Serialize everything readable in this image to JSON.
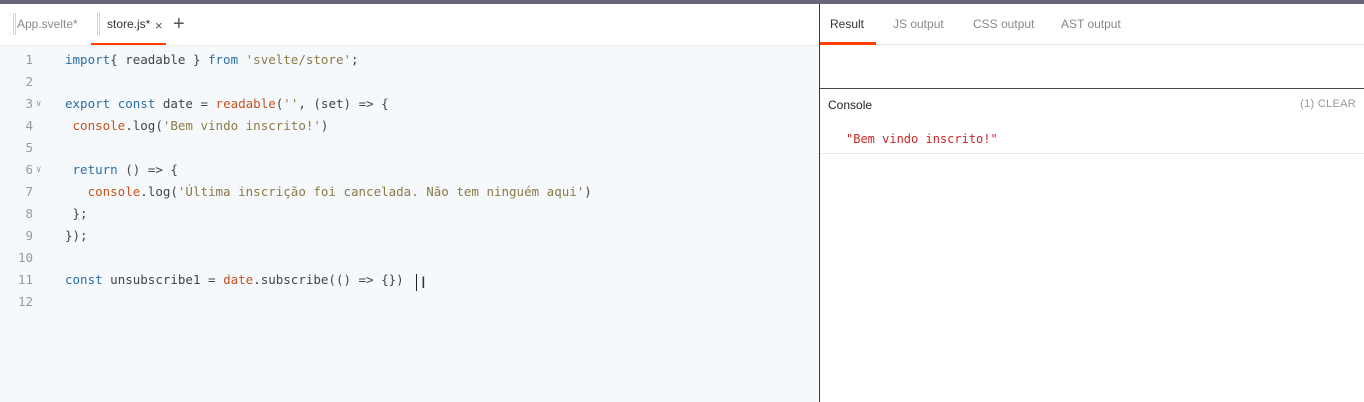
{
  "editor": {
    "tabs": [
      {
        "label": "App.svelte*"
      },
      {
        "label": "store.js*",
        "close": "×"
      }
    ],
    "add_tab": "+",
    "lines": [
      {
        "n": "1",
        "fold": false,
        "tokens": [
          [
            "kw",
            "import"
          ],
          [
            "",
            "{ readable } "
          ],
          [
            "kw",
            "from"
          ],
          [
            "",
            " "
          ],
          [
            "str",
            "'svelte/store'"
          ],
          [
            "",
            ";"
          ]
        ]
      },
      {
        "n": "2",
        "fold": false,
        "tokens": []
      },
      {
        "n": "3",
        "fold": true,
        "tokens": [
          [
            "kw",
            "export"
          ],
          [
            "",
            " "
          ],
          [
            "kw",
            "const"
          ],
          [
            "",
            " date = "
          ],
          [
            "fn",
            "readable"
          ],
          [
            "",
            "("
          ],
          [
            "str",
            "''"
          ],
          [
            "",
            ", (set) => {"
          ]
        ]
      },
      {
        "n": "4",
        "fold": false,
        "tokens": [
          [
            "",
            " "
          ],
          [
            "fn",
            "console"
          ],
          [
            "",
            ".log("
          ],
          [
            "str",
            "'Bem vindo inscrito!'"
          ],
          [
            "",
            ")"
          ]
        ]
      },
      {
        "n": "5",
        "fold": false,
        "tokens": []
      },
      {
        "n": "6",
        "fold": true,
        "tokens": [
          [
            "",
            " "
          ],
          [
            "kw",
            "return"
          ],
          [
            "",
            " () => {"
          ]
        ]
      },
      {
        "n": "7",
        "fold": false,
        "tokens": [
          [
            "",
            "   "
          ],
          [
            "fn",
            "console"
          ],
          [
            "",
            ".log("
          ],
          [
            "str",
            "'Última inscrição foi cancelada. Não tem ninguém aqui'"
          ],
          [
            "",
            ")"
          ]
        ]
      },
      {
        "n": "8",
        "fold": false,
        "tokens": [
          [
            "",
            " };"
          ]
        ]
      },
      {
        "n": "9",
        "fold": false,
        "tokens": [
          [
            "",
            "});"
          ]
        ]
      },
      {
        "n": "10",
        "fold": false,
        "tokens": []
      },
      {
        "n": "11",
        "fold": false,
        "tokens": [
          [
            "kw",
            "const"
          ],
          [
            "",
            " unsubscribe1 = "
          ],
          [
            "fn",
            "date"
          ],
          [
            "",
            ".subscribe(() => {})"
          ]
        ]
      },
      {
        "n": "12",
        "fold": false,
        "tokens": []
      }
    ]
  },
  "output": {
    "tabs": [
      {
        "label": "Result",
        "active": true
      },
      {
        "label": "JS output"
      },
      {
        "label": "CSS output"
      },
      {
        "label": "AST output"
      }
    ],
    "console": {
      "title": "Console",
      "clear": "(1) CLEAR",
      "messages": [
        "\"Bem vindo inscrito!\""
      ]
    }
  },
  "colors": {
    "accent": "#ff3e00",
    "keyword": "#2b6ea8",
    "function": "#c7531f",
    "string": "#8c7a48",
    "console_message": "#c62828"
  }
}
